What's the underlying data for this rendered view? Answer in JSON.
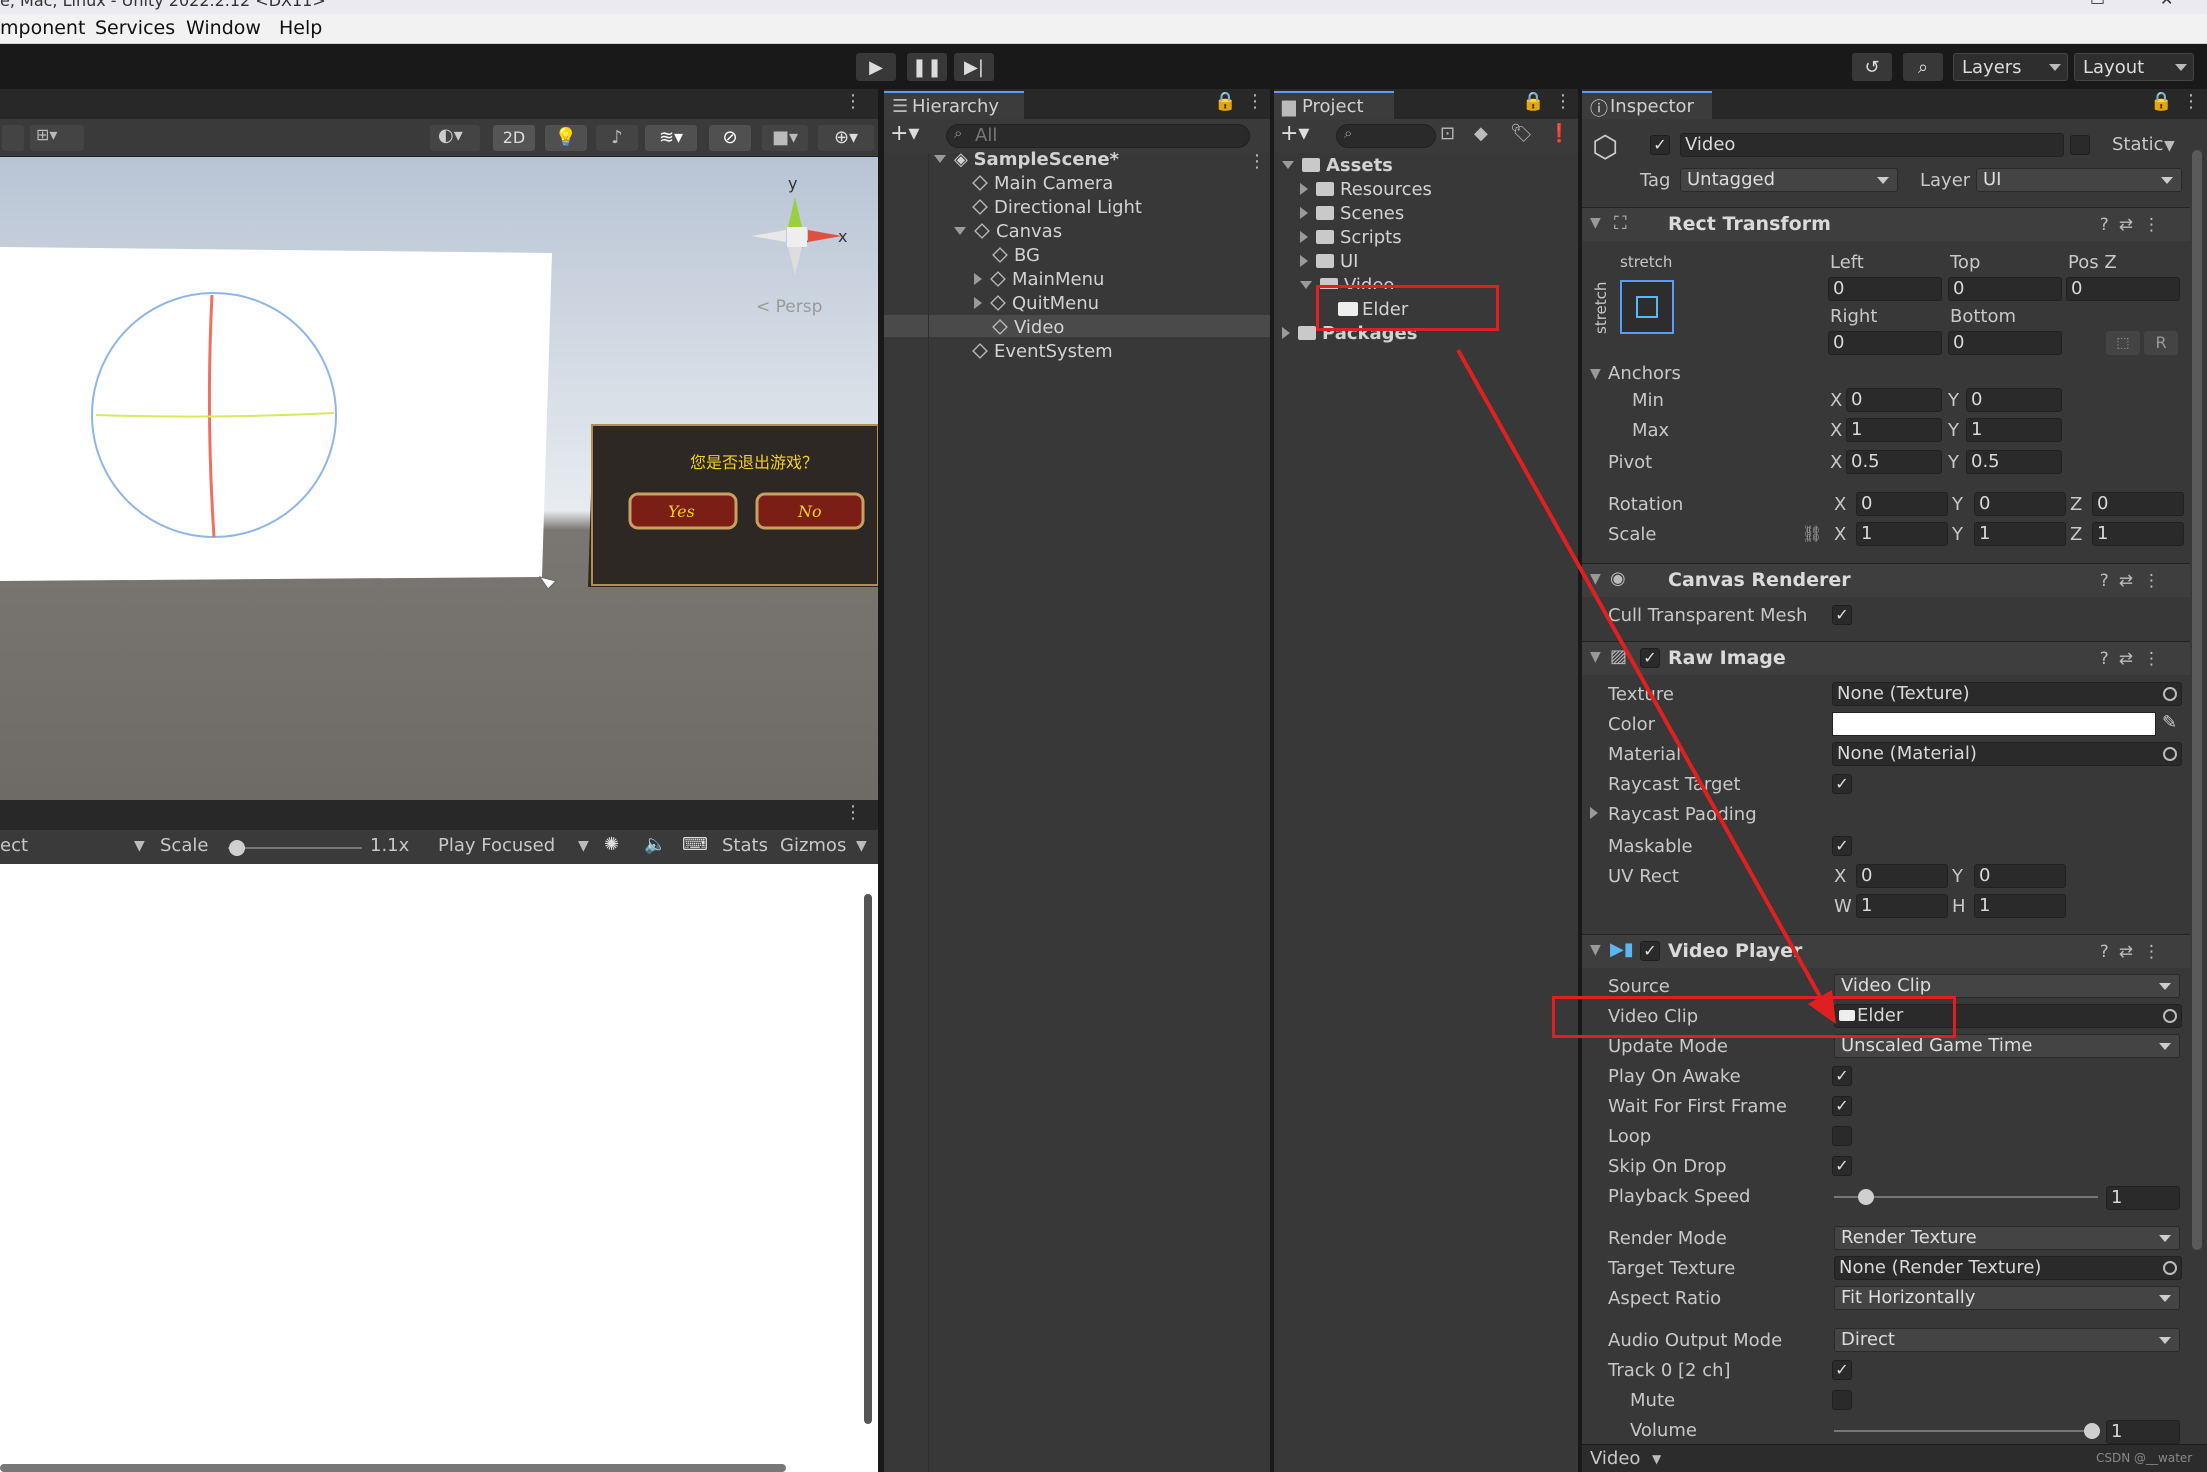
{
  "window": {
    "title": "e, Mac, Linux - Unity 2022.2.12 <DX11>"
  },
  "menu": [
    "mponent",
    "Services",
    "Window",
    "Help"
  ],
  "toolbar": {
    "layers_label": "Layers",
    "layout_label": "Layout"
  },
  "scene": {
    "toggle_2d": "2D",
    "persp_label": "< Persp",
    "axis_y": "y",
    "axis_x": "x",
    "dialog_text": "您是否退出游戏？",
    "dialog_yes": "Yes",
    "dialog_no": "No"
  },
  "game": {
    "display_dd": "ect",
    "scale_label": "Scale",
    "scale_value": "1.1x",
    "play_focused": "Play Focused",
    "stats": "Stats",
    "gizmos": "Gizmos"
  },
  "hierarchy": {
    "tab": "Hierarchy",
    "search_placeholder": "All",
    "items": [
      "SampleScene*",
      "Main Camera",
      "Directional Light",
      "Canvas",
      "BG",
      "MainMenu",
      "QuitMenu",
      "Video",
      "EventSystem"
    ]
  },
  "project": {
    "tab": "Project",
    "items": [
      "Assets",
      "Resources",
      "Scenes",
      "Scripts",
      "UI",
      "Video",
      "Elder",
      "Packages"
    ]
  },
  "inspector": {
    "tab": "Inspector",
    "object_name": "Video",
    "static_label": "Static",
    "tag_label": "Tag",
    "tag_value": "Untagged",
    "layer_label": "Layer",
    "layer_value": "UI",
    "rect": {
      "title": "Rect Transform",
      "stretch": "stretch",
      "h_left": "Left",
      "h_top": "Top",
      "h_posz": "Pos Z",
      "left": "0",
      "top": "0",
      "posz": "0",
      "h_right": "Right",
      "h_bottom": "Bottom",
      "right": "0",
      "bottom": "0",
      "anchors": "Anchors",
      "min": "Min",
      "max": "Max",
      "min_x": "0",
      "min_y": "0",
      "max_x": "1",
      "max_y": "1",
      "pivot": "Pivot",
      "pivot_x": "0.5",
      "pivot_y": "0.5",
      "rotation": "Rotation",
      "rot_x": "0",
      "rot_y": "0",
      "rot_z": "0",
      "scale": "Scale",
      "scale_x": "1",
      "scale_y": "1",
      "scale_z": "1",
      "lx": "X",
      "ly": "Y",
      "lz": "Z",
      "r_btn": "R"
    },
    "canvas_renderer": {
      "title": "Canvas Renderer",
      "cull": "Cull Transparent Mesh"
    },
    "raw_image": {
      "title": "Raw Image",
      "texture": "Texture",
      "texture_value": "None (Texture)",
      "color": "Color",
      "material": "Material",
      "material_value": "None (Material)",
      "raycast_target": "Raycast Target",
      "raycast_padding": "Raycast Padding",
      "maskable": "Maskable",
      "uv_rect": "UV Rect",
      "uv_x": "0",
      "uv_y": "0",
      "uv_w": "1",
      "uv_h": "1",
      "lx": "X",
      "ly": "Y",
      "lw": "W",
      "lh": "H"
    },
    "video_player": {
      "title": "Video Player",
      "source": "Source",
      "source_value": "Video Clip",
      "video_clip": "Video Clip",
      "video_clip_value": "Elder",
      "update_mode": "Update Mode",
      "update_mode_value": "Unscaled Game Time",
      "play_on_awake": "Play On Awake",
      "wait_first_frame": "Wait For First Frame",
      "loop": "Loop",
      "skip_on_drop": "Skip On Drop",
      "playback_speed": "Playback Speed",
      "playback_speed_value": "1",
      "render_mode": "Render Mode",
      "render_mode_value": "Render Texture",
      "target_texture": "Target Texture",
      "target_texture_value": "None (Render Texture)",
      "aspect_ratio": "Aspect Ratio",
      "aspect_ratio_value": "Fit Horizontally",
      "audio_output": "Audio Output Mode",
      "audio_output_value": "Direct",
      "track0": "Track 0 [2 ch]",
      "mute": "Mute",
      "volume": "Volume",
      "volume_value": "1"
    },
    "footer_label": "Video",
    "watermark": "CSDN @__water"
  },
  "colors": {
    "accent": "#5a9cf8",
    "highlight_red": "#e02020",
    "panel_bg": "#383838",
    "dark_bg": "#191919"
  }
}
